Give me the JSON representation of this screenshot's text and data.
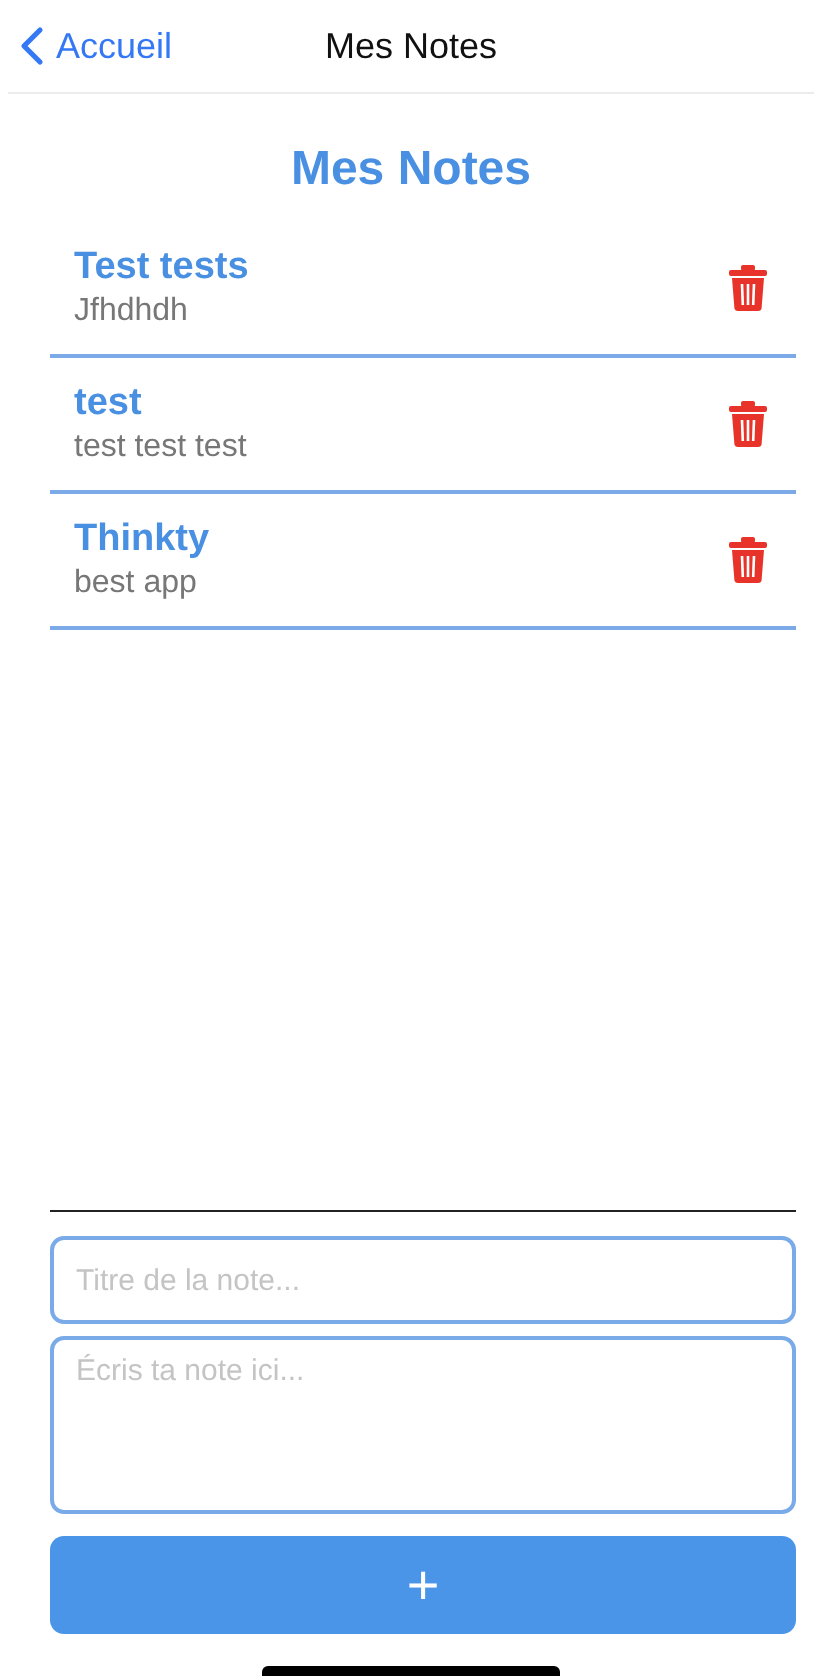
{
  "nav": {
    "back_label": "Accueil",
    "title": "Mes Notes"
  },
  "heading": "Mes Notes",
  "notes": [
    {
      "title": "Test tests",
      "body": "Jfhdhdh"
    },
    {
      "title": "test",
      "body": "test test test"
    },
    {
      "title": "Thinkty",
      "body": "best app"
    }
  ],
  "form": {
    "title_field": {
      "placeholder": "Titre de la note..."
    },
    "body_field": {
      "placeholder": "Écris ta note ici..."
    },
    "add_button": "+"
  }
}
